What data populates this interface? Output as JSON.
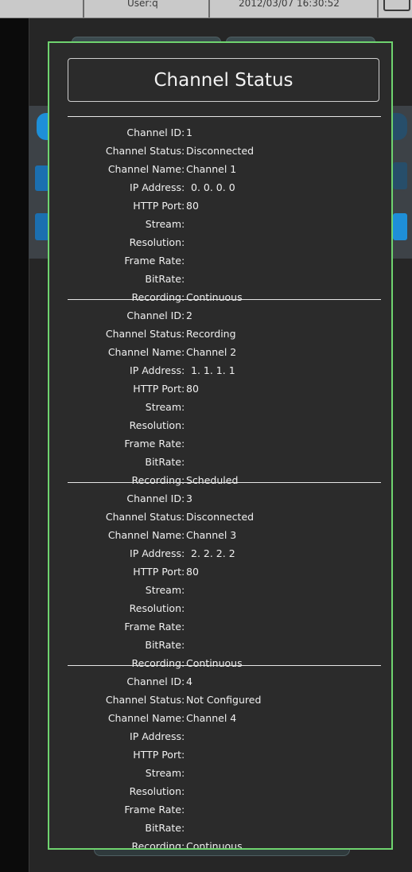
{
  "topbar": {
    "user_text": "User:q",
    "datetime": "2012/03/07 16:30:52",
    "icon": "monitor-icon"
  },
  "dialog": {
    "title": "Channel Status",
    "labels": {
      "channel_id": "Channel ID",
      "channel_status": "Channel Status",
      "channel_name": "Channel Name",
      "ip_address": "IP Address",
      "http_port": "HTTP Port",
      "stream": "Stream",
      "resolution": "Resolution",
      "frame_rate": "Frame Rate",
      "bitrate": "BitRate",
      "recording": "Recording"
    },
    "channels": [
      {
        "channel_id": "1",
        "channel_status": "Disconnected",
        "channel_name": "Channel 1",
        "ip_address": "0. 0. 0. 0",
        "http_port": "80",
        "stream": "",
        "resolution": "",
        "frame_rate": "",
        "bitrate": "",
        "recording": "Continuous"
      },
      {
        "channel_id": "2",
        "channel_status": "Recording",
        "channel_name": "Channel 2",
        "ip_address": "1. 1. 1. 1",
        "http_port": "80",
        "stream": "",
        "resolution": "",
        "frame_rate": "",
        "bitrate": "",
        "recording": "Scheduled"
      },
      {
        "channel_id": "3",
        "channel_status": "Disconnected",
        "channel_name": "Channel 3",
        "ip_address": "2. 2. 2. 2",
        "http_port": "80",
        "stream": "",
        "resolution": "",
        "frame_rate": "",
        "bitrate": "",
        "recording": "Continuous"
      },
      {
        "channel_id": "4",
        "channel_status": "Not Configured",
        "channel_name": "Channel 4",
        "ip_address": "",
        "http_port": "",
        "stream": "",
        "resolution": "",
        "frame_rate": "",
        "bitrate": "",
        "recording": "Continuous"
      }
    ]
  },
  "colors": {
    "dialog_border": "#6fd36f",
    "dialog_bg": "#2b2b2b",
    "text": "#f0f0f0",
    "accent_blue": "#1e8fd8"
  }
}
